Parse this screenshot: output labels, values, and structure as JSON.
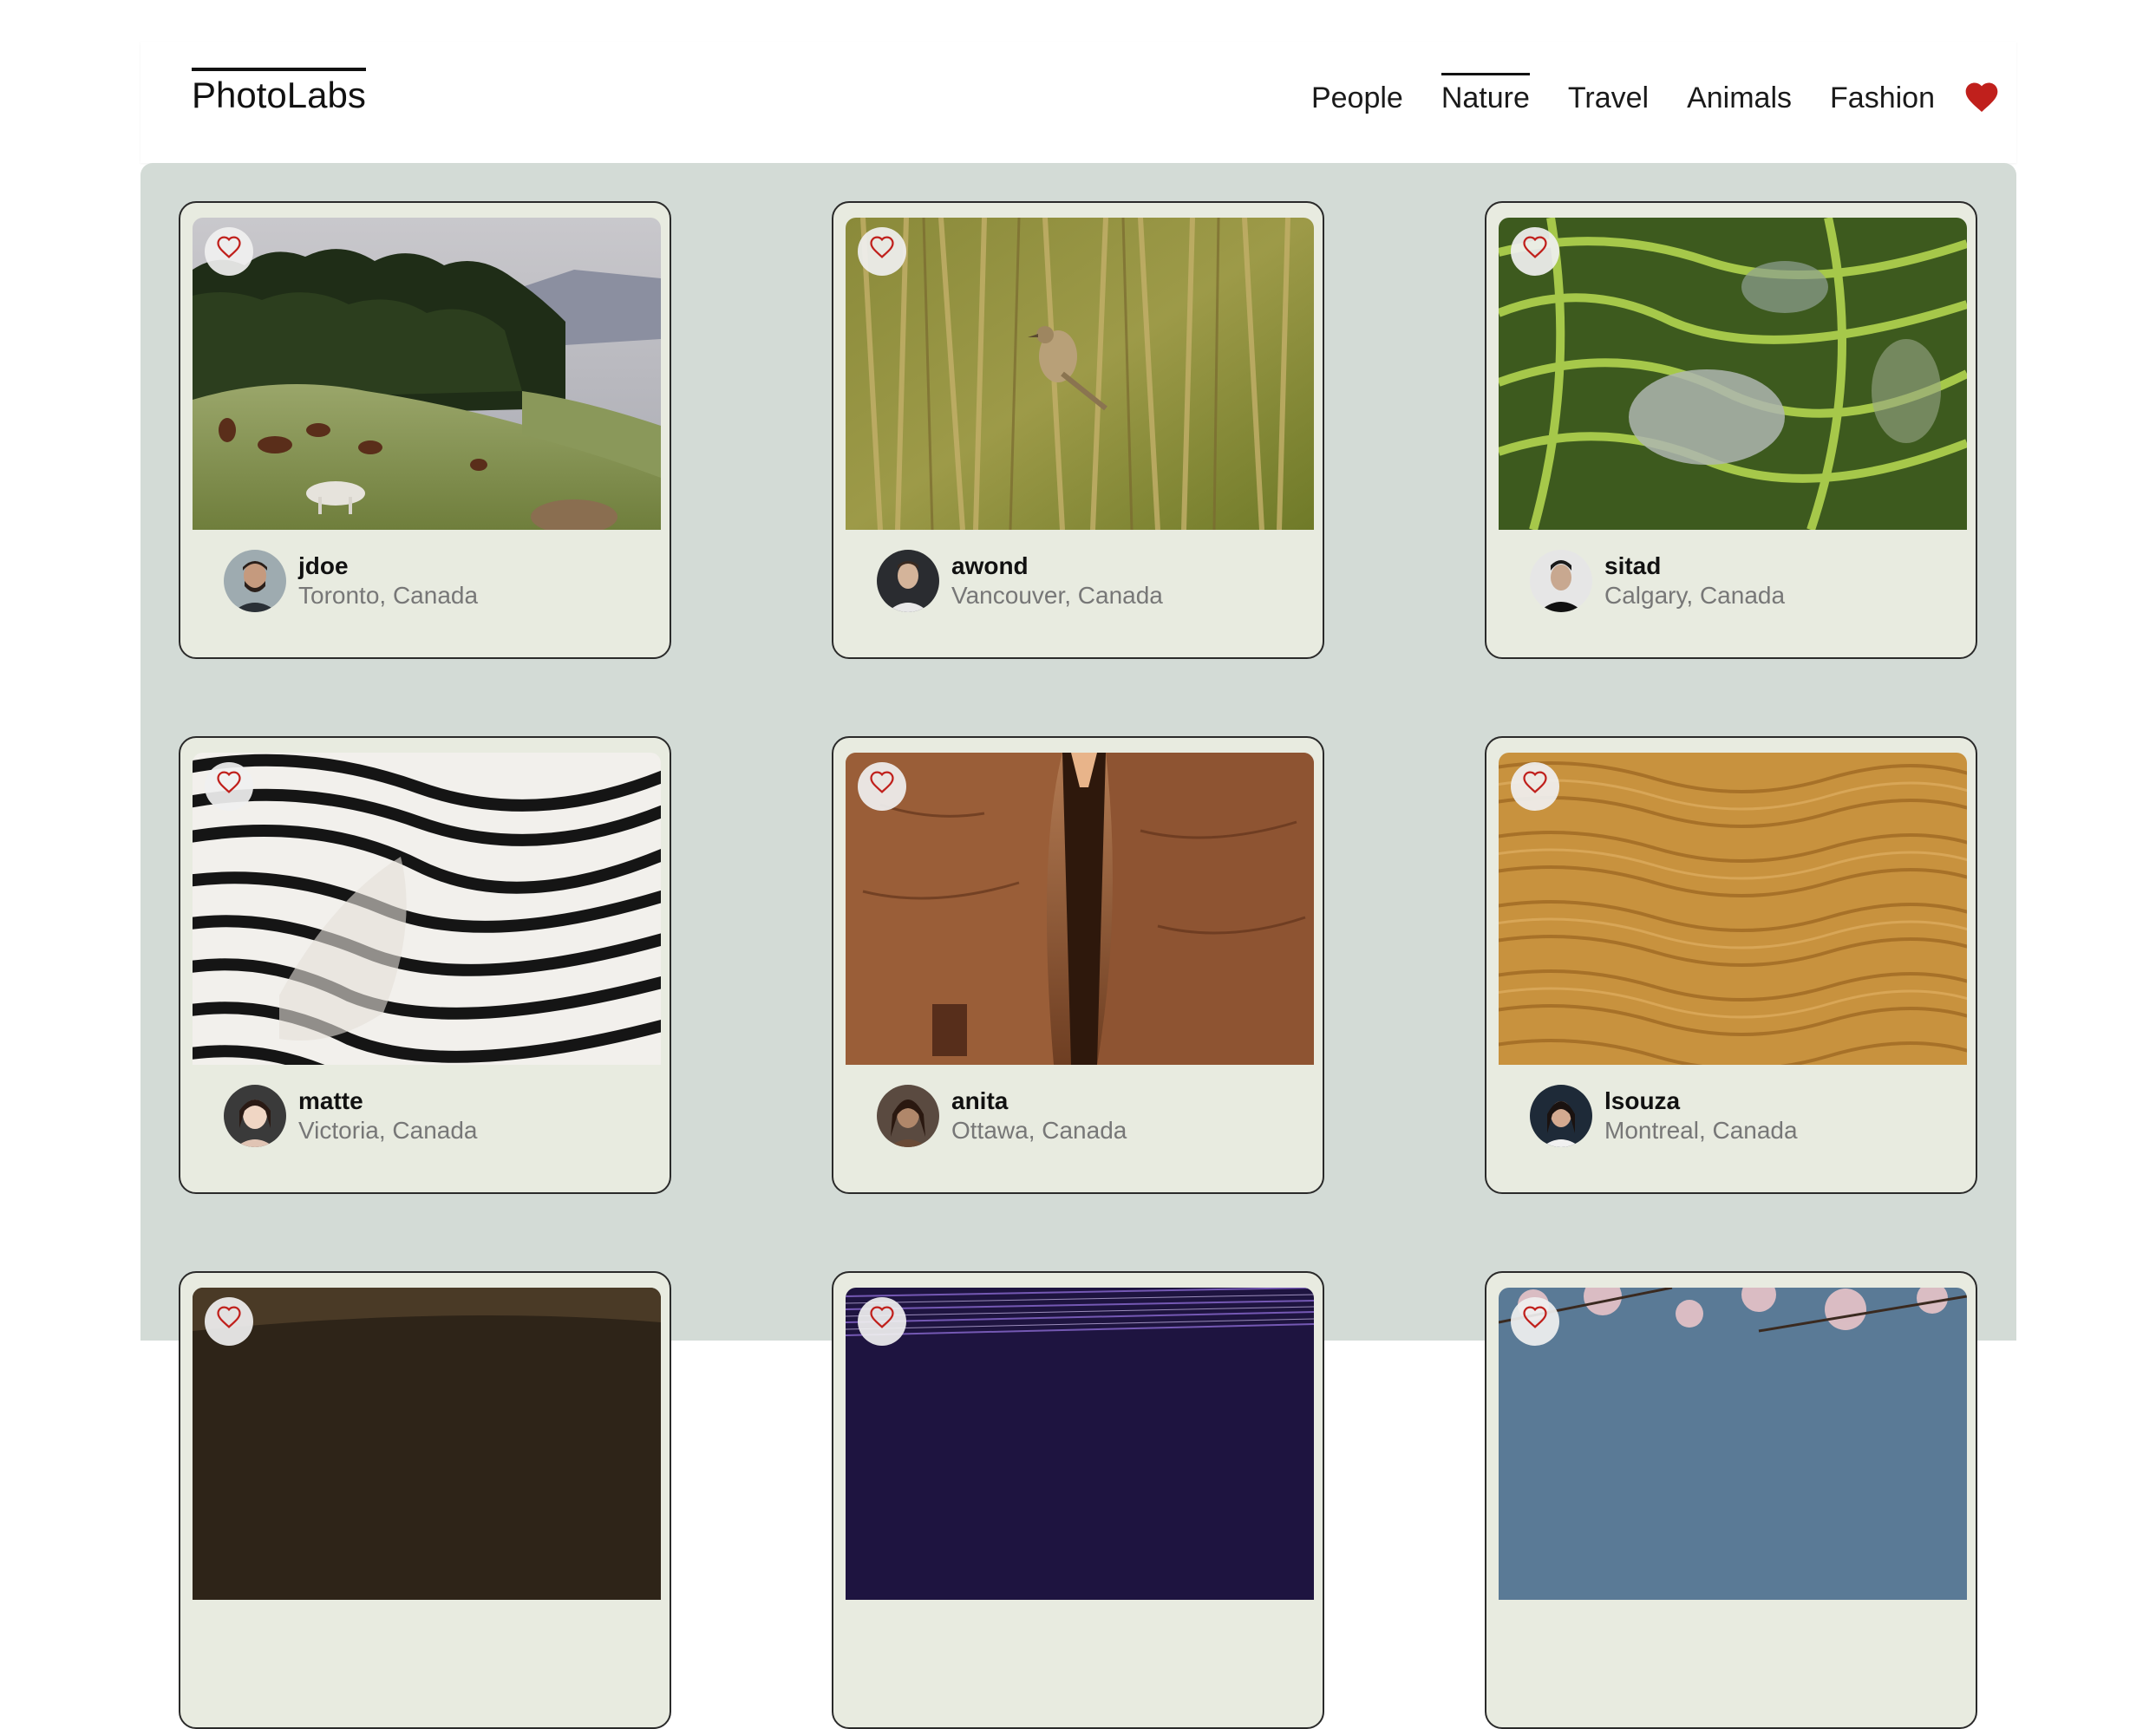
{
  "app": {
    "logo": "PhotoLabs",
    "topics": [
      {
        "label": "People",
        "active": false
      },
      {
        "label": "Nature",
        "active": true
      },
      {
        "label": "Travel",
        "active": false
      },
      {
        "label": "Animals",
        "active": false
      },
      {
        "label": "Fashion",
        "active": false
      }
    ],
    "fav_badge_icon": "heart-filled-icon",
    "accent_color": "#c0201c",
    "gallery_bg": "#d3dbd6",
    "card_bg": "#e8ebe0"
  },
  "photos": [
    {
      "username": "jdoe",
      "location": "Toronto, Canada",
      "subject": "horses grazing on hillside"
    },
    {
      "username": "awond",
      "location": "Vancouver, Canada",
      "subject": "bird in reeds"
    },
    {
      "username": "sitad",
      "location": "Calgary, Canada",
      "subject": "rice terraces"
    },
    {
      "username": "matte",
      "location": "Victoria, Canada",
      "subject": "zebra stripes"
    },
    {
      "username": "anita",
      "location": "Ottawa, Canada",
      "subject": "canyon rock walls"
    },
    {
      "username": "lsouza",
      "location": "Montreal, Canada",
      "subject": "desert sand ripples"
    },
    {
      "username": "",
      "location": "",
      "subject": "dark landscape"
    },
    {
      "username": "",
      "location": "",
      "subject": "star trails"
    },
    {
      "username": "",
      "location": "",
      "subject": "cherry blossoms"
    }
  ]
}
